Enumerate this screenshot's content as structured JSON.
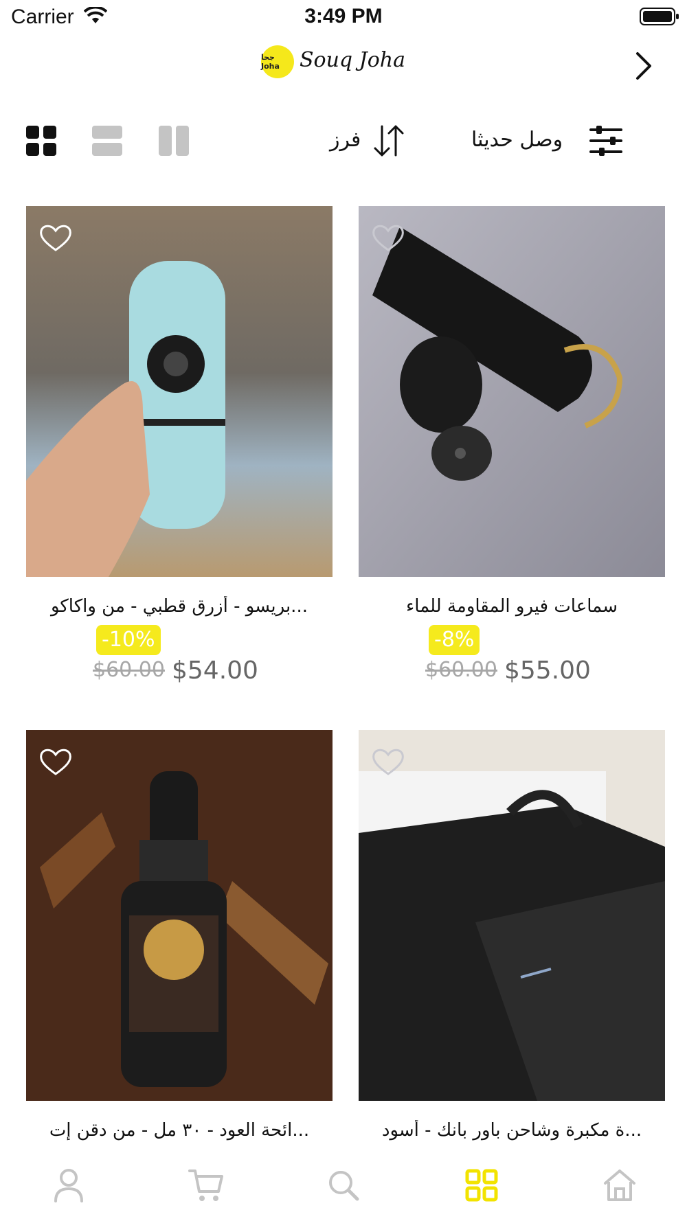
{
  "status_bar": {
    "carrier": "Carrier",
    "time": "3:49 PM"
  },
  "header": {
    "logo_mark": "جحا Joha",
    "logo_text": "Souq Joha"
  },
  "toolbar": {
    "sort_label": "فرز",
    "filter_label": "وصل حديثا"
  },
  "products": [
    {
      "title": "سماعات فيرو المقاومة للماء",
      "discount": "-8%",
      "old_price": "$60.00",
      "price": "$55.00",
      "image": "earbuds-photo"
    },
    {
      "title": "...بريسو - أزرق قطبي - من واكاكو",
      "discount": "-10%",
      "old_price": "$60.00",
      "price": "$54.00",
      "image": "nanopresso-photo"
    },
    {
      "title": "...ة مكبرة وشاحن باور بانك - أسود",
      "image": "power-bank-photo"
    },
    {
      "title": "...ائحة العود - ٣٠ مل - من دقن إت",
      "image": "beard-oil-photo"
    }
  ],
  "colors": {
    "accent": "#f5ea1d",
    "price": "#666666",
    "old_price": "#a7a7a7",
    "icon_gray": "#bdbdbd"
  }
}
